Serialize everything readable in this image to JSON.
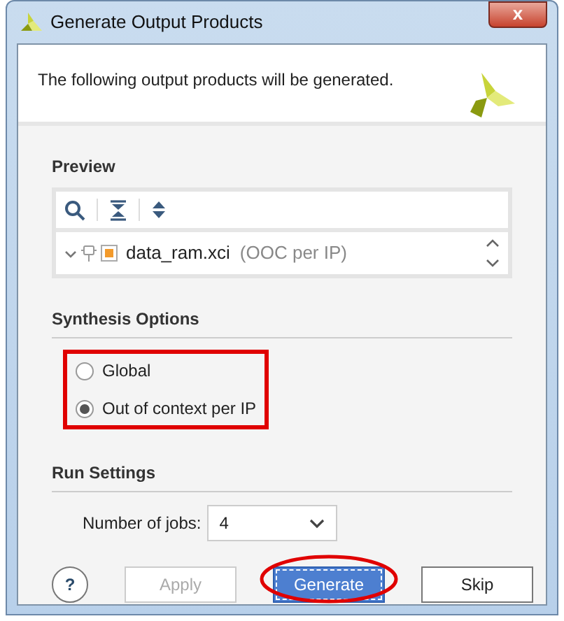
{
  "window": {
    "title": "Generate Output Products",
    "close": "x"
  },
  "header": {
    "message": "The following output products will be generated."
  },
  "preview": {
    "title": "Preview",
    "items": [
      {
        "name": "data_ram.xci",
        "note": "(OOC per IP)",
        "expanded": true
      }
    ]
  },
  "synthesis_options": {
    "title": "Synthesis Options",
    "options": [
      {
        "label": "Global",
        "selected": false
      },
      {
        "label": "Out of context per IP",
        "selected": true
      }
    ]
  },
  "run_settings": {
    "title": "Run Settings",
    "jobs_label": "Number of jobs:",
    "jobs_value": "4"
  },
  "buttons": [
    {
      "kind": "help",
      "label": "?",
      "disabled": false
    },
    {
      "kind": "normal",
      "label": "Apply",
      "disabled": true
    },
    {
      "kind": "default",
      "label": "Generate",
      "disabled": false
    },
    {
      "kind": "normal",
      "label": "Skip",
      "disabled": false
    }
  ]
}
